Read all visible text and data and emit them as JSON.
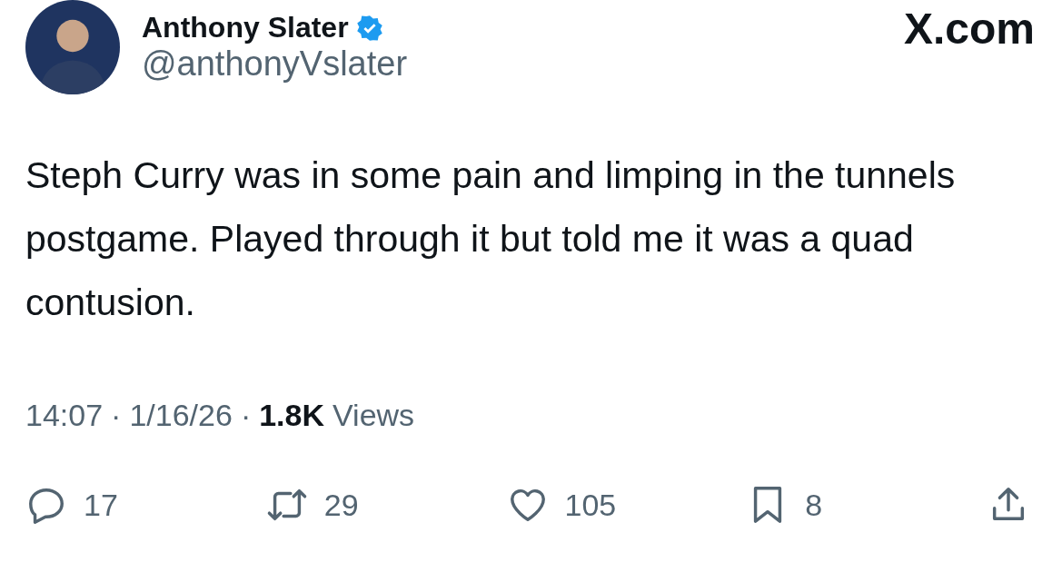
{
  "author": {
    "name": "Anthony Slater",
    "verified": true,
    "handle": "@anthonyVslater"
  },
  "site": "X.com",
  "text": "Steph Curry was in some pain and limping in the tunnels postgame. Played through it but told me it was a quad contusion.",
  "meta": {
    "separator": "·",
    "time": "14:07",
    "date": "1/16/26",
    "views_count": "1.8K",
    "views_label": "Views"
  },
  "actions": [
    {
      "kind": "reply",
      "count": "17"
    },
    {
      "kind": "repost",
      "count": "29"
    },
    {
      "kind": "like",
      "count": "105"
    },
    {
      "kind": "bookmark",
      "count": "8"
    },
    {
      "kind": "share"
    }
  ]
}
